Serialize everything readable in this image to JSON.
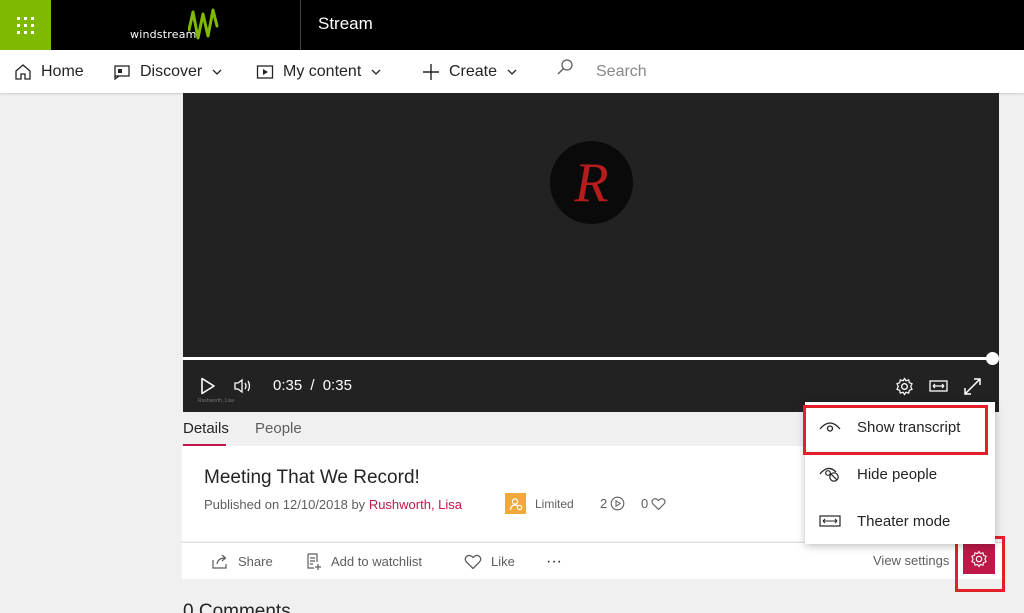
{
  "topbar": {
    "brand_name": "windstream",
    "app_title": "Stream"
  },
  "nav": {
    "home": "Home",
    "discover": "Discover",
    "my_content": "My content",
    "create": "Create",
    "search_placeholder": "Search"
  },
  "player": {
    "logo_letter": "R",
    "current_time": "0:35",
    "separator": "/",
    "duration": "0:35",
    "progress": 1.0,
    "watermark": "Rushworth, Lisa"
  },
  "tabs": [
    {
      "label": "Details",
      "active": true
    },
    {
      "label": "People",
      "active": false
    }
  ],
  "video": {
    "title": "Meeting That We Record!",
    "published_prefix": "Published on 12/10/2018 by",
    "author": "Rushworth, Lisa",
    "visibility": "Limited",
    "views": "2",
    "likes": "0"
  },
  "actions": {
    "share": "Share",
    "watchlist": "Add to watchlist",
    "like": "Like",
    "more": "···",
    "view_settings": "View settings"
  },
  "comments": {
    "heading": "0 Comments"
  },
  "menu": {
    "items": [
      {
        "label": "Show transcript",
        "icon": "eye-icon"
      },
      {
        "label": "Hide people",
        "icon": "hide-people-icon"
      },
      {
        "label": "Theater mode",
        "icon": "theater-icon"
      }
    ]
  },
  "colors": {
    "accent": "#bc1948",
    "waffle": "#7fba00",
    "highlight": "#e3202a",
    "limited_badge": "#f2a93b"
  }
}
